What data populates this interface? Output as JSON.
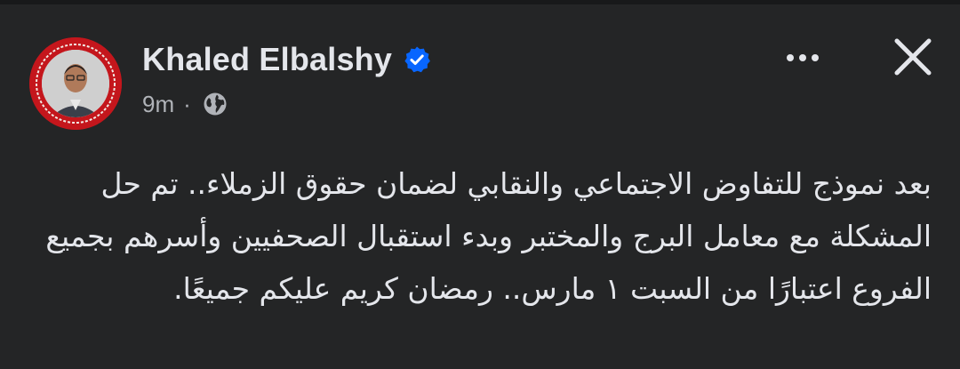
{
  "post": {
    "author": {
      "name": "Khaled Elbalshy",
      "verified": true
    },
    "meta": {
      "time": "9m",
      "separator": "·",
      "audience_icon": "globe-icon"
    },
    "actions": {
      "more_icon": "more-dots-icon",
      "close_icon": "close-icon"
    },
    "text": "بعد نموذج للتفاوض الاجتماعي والنقابي لضمان حقوق الزملاء.. تم حل المشكلة مع معامل البرج والمختبر وبدء استقبال الصحفيين وأسرهم بجميع الفروع اعتبارًا من السبت ١ مارس.. رمضان كريم عليكم جميعًا."
  },
  "colors": {
    "background": "#242526",
    "text_primary": "#e4e6eb",
    "text_secondary": "#b0b3b8",
    "verified_badge": "#0866ff",
    "avatar_ring": "#c4161c"
  }
}
